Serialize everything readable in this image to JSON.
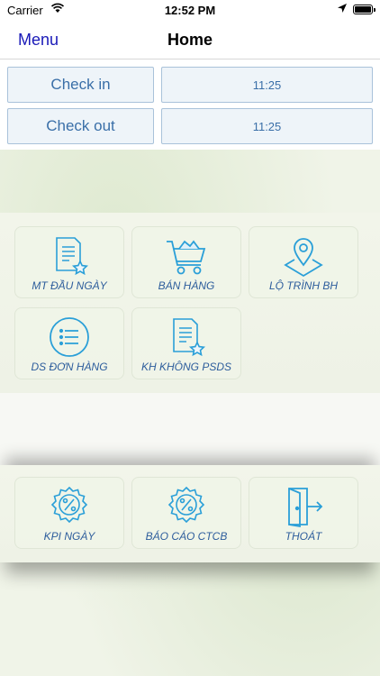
{
  "status_bar": {
    "carrier": "Carrier",
    "time": "12:52 PM"
  },
  "nav": {
    "menu_label": "Menu",
    "title": "Home"
  },
  "checks": {
    "check_in_label": "Check in",
    "check_in_time": "11:25",
    "check_out_label": "Check out",
    "check_out_time": "11:25"
  },
  "tiles_top": [
    {
      "label": "MT ĐẦU NGÀY",
      "icon": "document-star-icon"
    },
    {
      "label": "BÁN HÀNG",
      "icon": "shopping-cart-icon"
    },
    {
      "label": "LỘ TRÌNH BH",
      "icon": "map-pin-icon"
    },
    {
      "label": "DS ĐƠN HÀNG",
      "icon": "list-circle-icon"
    },
    {
      "label": "KH KHÔNG PSDS",
      "icon": "document-star-icon"
    }
  ],
  "tiles_bottom": [
    {
      "label": "KPI NGÀY",
      "icon": "percent-badge-icon"
    },
    {
      "label": "BÁO CÁO CTCB",
      "icon": "percent-badge-icon"
    },
    {
      "label": "THOÁT",
      "icon": "exit-door-icon"
    }
  ],
  "colors": {
    "icon_blue": "#2a9fd8",
    "label_blue": "#2d5d9c",
    "menu_blue": "#1a1ab8"
  }
}
